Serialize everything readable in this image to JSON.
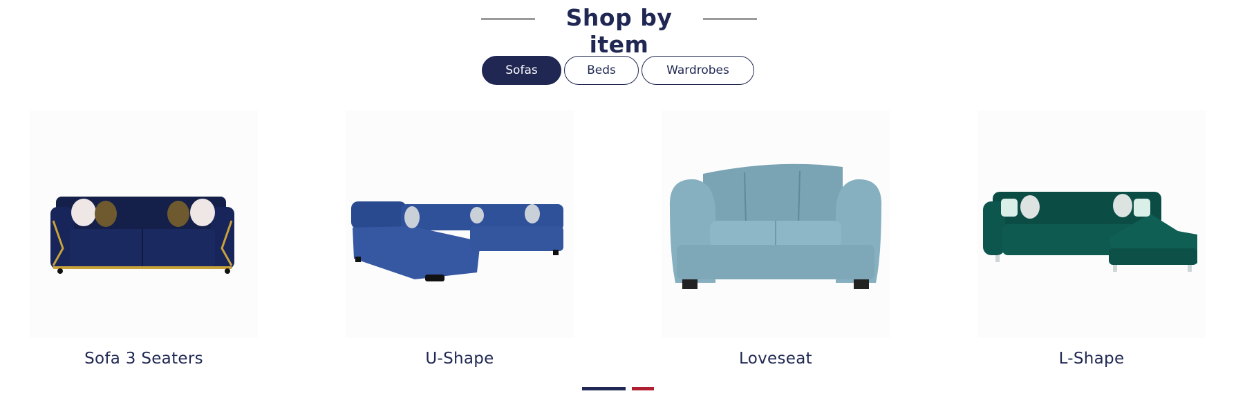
{
  "section": {
    "title": "Shop by item"
  },
  "tabs": [
    {
      "label": "Sofas",
      "active": true
    },
    {
      "label": "Beds",
      "active": false
    },
    {
      "label": "Wardrobes",
      "active": false
    }
  ],
  "products": [
    {
      "name": "Sofa 3 Seaters",
      "color": "#14224a"
    },
    {
      "name": "U-Shape",
      "color": "#2d4f96"
    },
    {
      "name": "Loveseat",
      "color": "#7fa8ba"
    },
    {
      "name": "L-Shape",
      "color": "#0a4a43"
    }
  ],
  "carousel": {
    "active_index": 0,
    "colors": {
      "active": "#1f2752",
      "inactive": "#b01e32"
    }
  },
  "colors": {
    "brand": "#1f2752",
    "accent": "#b01e32",
    "divider": "#9a9a9a"
  }
}
